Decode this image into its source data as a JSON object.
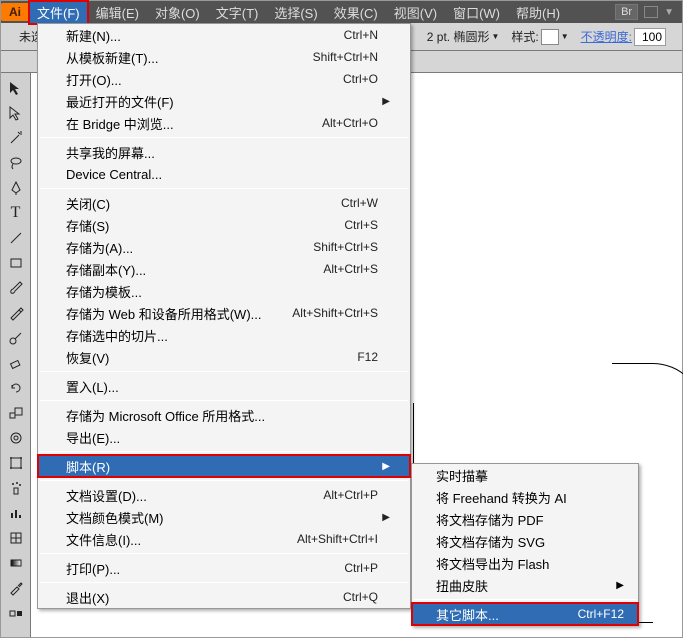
{
  "logo": "Ai",
  "menus": [
    "文件(F)",
    "编辑(E)",
    "对象(O)",
    "文字(T)",
    "选择(S)",
    "效果(C)",
    "视图(V)",
    "窗口(W)",
    "帮助(H)"
  ],
  "tail_br": "Br",
  "ctrl": {
    "left_label": "未选",
    "anchor_value": "",
    "stroke_label": "2 pt. 椭圆形",
    "style_label": "样式:",
    "opacity_label": "不透明度:",
    "opacity_value": "100"
  },
  "file_menu": [
    {
      "type": "item",
      "label": "新建(N)...",
      "shortcut": "Ctrl+N"
    },
    {
      "type": "item",
      "label": "从模板新建(T)...",
      "shortcut": "Shift+Ctrl+N"
    },
    {
      "type": "item",
      "label": "打开(O)...",
      "shortcut": "Ctrl+O"
    },
    {
      "type": "item",
      "label": "最近打开的文件(F)",
      "shortcut": "",
      "arrow": true
    },
    {
      "type": "item",
      "label": "在 Bridge 中浏览...",
      "shortcut": "Alt+Ctrl+O"
    },
    {
      "type": "sep"
    },
    {
      "type": "item",
      "label": "共享我的屏幕...",
      "shortcut": ""
    },
    {
      "type": "item",
      "label": "Device Central...",
      "shortcut": ""
    },
    {
      "type": "sep"
    },
    {
      "type": "item",
      "label": "关闭(C)",
      "shortcut": "Ctrl+W"
    },
    {
      "type": "item",
      "label": "存储(S)",
      "shortcut": "Ctrl+S"
    },
    {
      "type": "item",
      "label": "存储为(A)...",
      "shortcut": "Shift+Ctrl+S"
    },
    {
      "type": "item",
      "label": "存储副本(Y)...",
      "shortcut": "Alt+Ctrl+S"
    },
    {
      "type": "item",
      "label": "存储为模板...",
      "shortcut": ""
    },
    {
      "type": "item",
      "label": "存储为 Web 和设备所用格式(W)...",
      "shortcut": "Alt+Shift+Ctrl+S"
    },
    {
      "type": "item",
      "label": "存储选中的切片...",
      "shortcut": ""
    },
    {
      "type": "item",
      "label": "恢复(V)",
      "shortcut": "F12"
    },
    {
      "type": "sep"
    },
    {
      "type": "item",
      "label": "置入(L)...",
      "shortcut": ""
    },
    {
      "type": "sep"
    },
    {
      "type": "item",
      "label": "存储为 Microsoft Office 所用格式...",
      "shortcut": ""
    },
    {
      "type": "item",
      "label": "导出(E)...",
      "shortcut": ""
    },
    {
      "type": "sep"
    },
    {
      "type": "item",
      "label": "脚本(R)",
      "shortcut": "",
      "arrow": true,
      "hover": true,
      "highlight": true
    },
    {
      "type": "sep"
    },
    {
      "type": "item",
      "label": "文档设置(D)...",
      "shortcut": "Alt+Ctrl+P"
    },
    {
      "type": "item",
      "label": "文档颜色模式(M)",
      "shortcut": "",
      "arrow": true
    },
    {
      "type": "item",
      "label": "文件信息(I)...",
      "shortcut": "Alt+Shift+Ctrl+I"
    },
    {
      "type": "sep"
    },
    {
      "type": "item",
      "label": "打印(P)...",
      "shortcut": "Ctrl+P"
    },
    {
      "type": "sep"
    },
    {
      "type": "item",
      "label": "退出(X)",
      "shortcut": "Ctrl+Q"
    }
  ],
  "scripts_submenu": [
    {
      "type": "item",
      "label": "实时描摹",
      "shortcut": ""
    },
    {
      "type": "item",
      "label": "将 Freehand 转换为 AI",
      "shortcut": ""
    },
    {
      "type": "item",
      "label": "将文档存储为 PDF",
      "shortcut": ""
    },
    {
      "type": "item",
      "label": "将文档存储为 SVG",
      "shortcut": ""
    },
    {
      "type": "item",
      "label": "将文档导出为 Flash",
      "shortcut": ""
    },
    {
      "type": "item",
      "label": "扭曲皮肤",
      "shortcut": "",
      "arrow": true
    },
    {
      "type": "sep"
    },
    {
      "type": "item",
      "label": "其它脚本...",
      "shortcut": "Ctrl+F12",
      "hover": true,
      "highlight": true
    }
  ]
}
